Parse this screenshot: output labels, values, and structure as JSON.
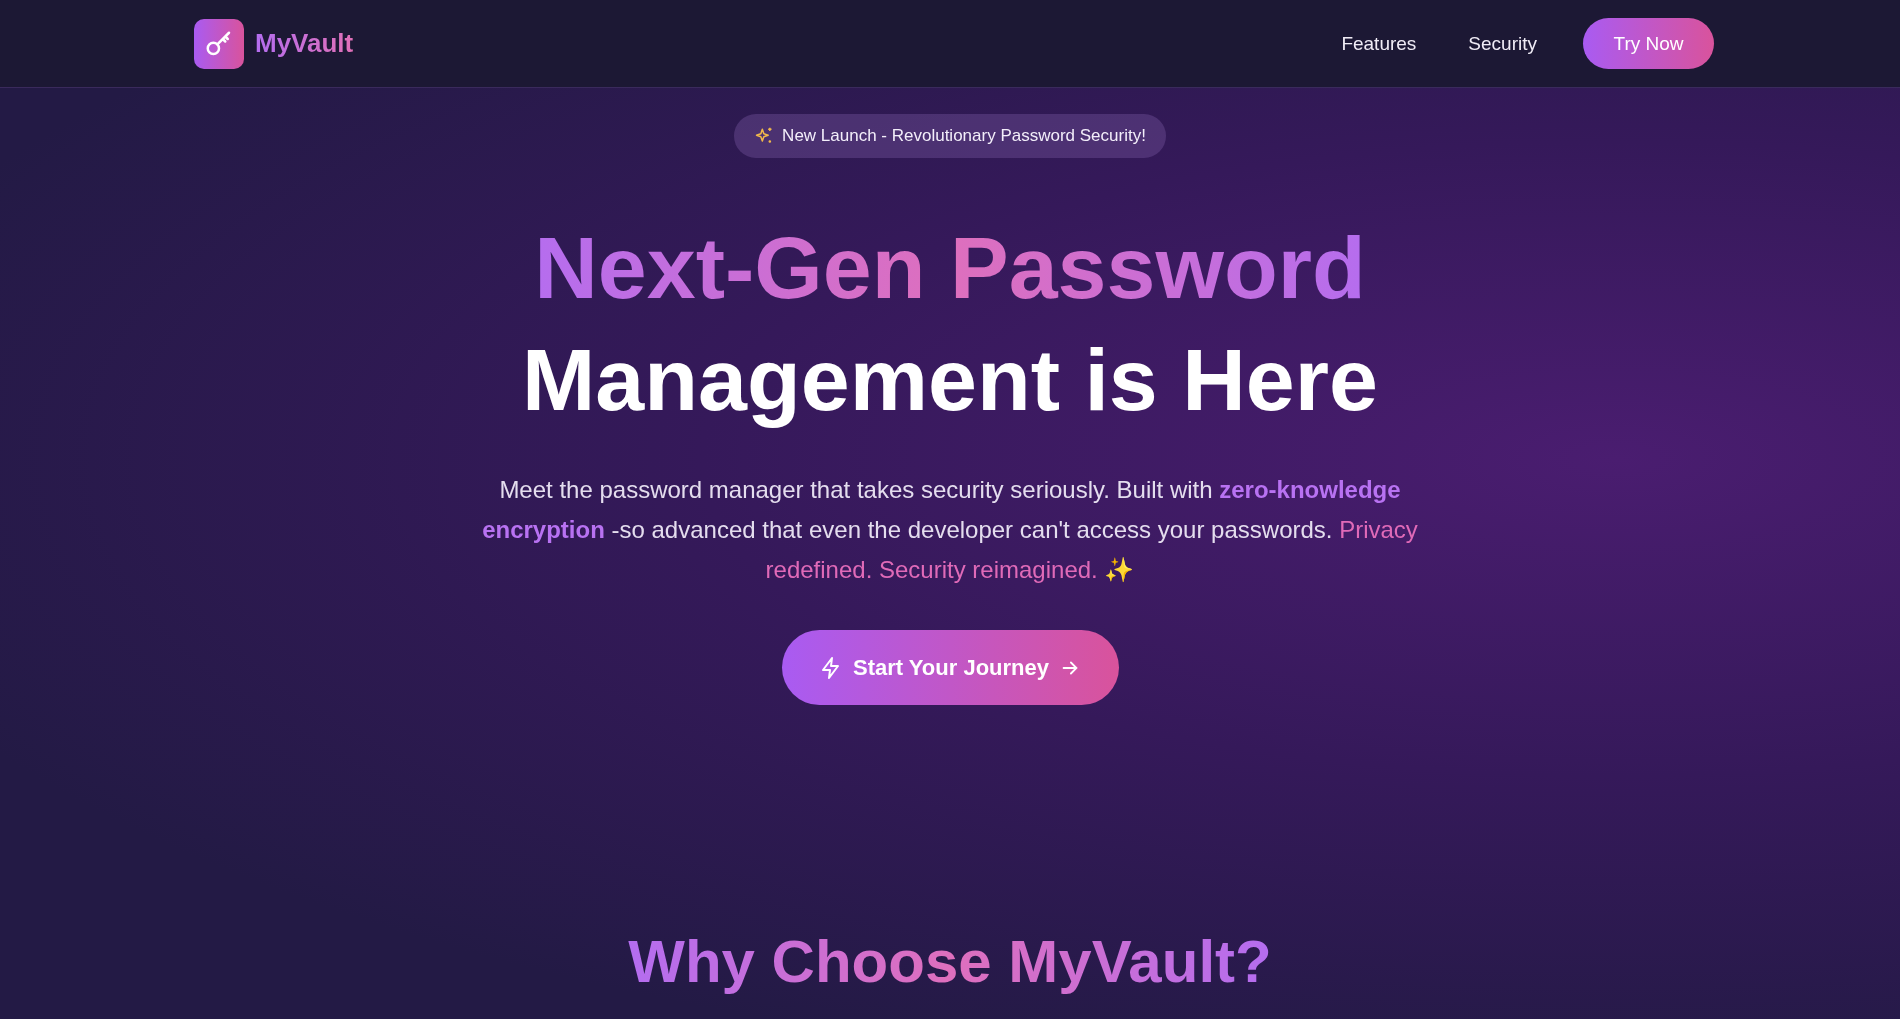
{
  "nav": {
    "brand": "MyVault",
    "links": [
      "Features",
      "Security"
    ],
    "cta": "Try Now"
  },
  "hero": {
    "badge": "New Launch - Revolutionary Password Security!",
    "headline": [
      "Next-Gen Password",
      "Management is Here"
    ],
    "intro": [
      {
        "kind": "plain",
        "text": "Meet the password manager that takes security seriously. Built with "
      },
      {
        "kind": "highlight",
        "text": "zero-knowledge encryption"
      },
      {
        "kind": "plain",
        "text": " -so advanced that even the developer can't access your passwords. "
      },
      {
        "kind": "accent",
        "text": "Privacy redefined. Security reimagined."
      },
      {
        "kind": "plain",
        "text": " ✨"
      }
    ],
    "button": "Start Your Journey"
  },
  "section_title": "Why Choose MyVault?"
}
